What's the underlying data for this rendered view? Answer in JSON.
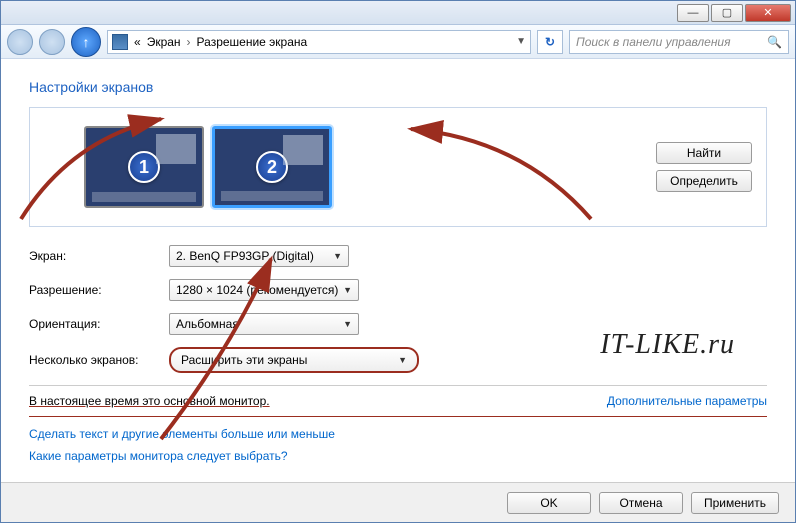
{
  "titlebar": {
    "min": "—",
    "max": "▢",
    "close": "✕"
  },
  "nav": {
    "crumb1": "Экран",
    "crumb2": "Разрешение экрана",
    "sep": "›",
    "prefix": "«",
    "refresh": "↻",
    "search_placeholder": "Поиск в панели управления"
  },
  "heading": "Настройки экранов",
  "preview": {
    "monitor1": "1",
    "monitor2": "2",
    "find": "Найти",
    "detect": "Определить"
  },
  "form": {
    "screen_label": "Экран:",
    "screen_value": "2. BenQ FP93GP (Digital)",
    "resolution_label": "Разрешение:",
    "resolution_value": "1280 × 1024 (рекомендуется)",
    "orientation_label": "Ориентация:",
    "orientation_value": "Альбомная",
    "multi_label": "Несколько экранов:",
    "multi_value": "Расширить эти экраны"
  },
  "status": {
    "text": "В настоящее время это основной монитор.",
    "advanced": "Дополнительные параметры"
  },
  "links": {
    "l1": "Сделать текст и другие элементы больше или меньше",
    "l2": "Какие параметры монитора следует выбрать?"
  },
  "footer": {
    "ok": "OK",
    "cancel": "Отмена",
    "apply": "Применить"
  },
  "watermark": "IT-LIKE.ru"
}
